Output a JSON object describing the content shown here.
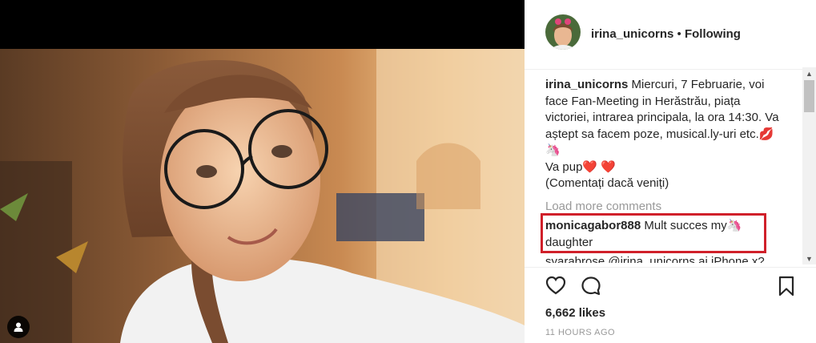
{
  "post": {
    "username": "irina_unicorns",
    "separator": " • ",
    "follow_status": "Following",
    "caption_user": "irina_unicorns",
    "caption_lines": [
      "Miercuri, 7 Februarie, voi",
      "face Fan-Meeting in Herăstrău, piața",
      "victoriei, intrarea principala, la ora 14:30. Va",
      "aștept sa facem poze, musical.ly-uri etc.💋",
      "🦄",
      "Va pup❤️ ❤️",
      "(Comentați dacă veniți)"
    ],
    "load_more": "Load more comments",
    "comments": [
      {
        "user": "monicagabor888",
        "text": "Mult succes my🦄",
        "text2": "daughter"
      },
      {
        "user": "syarabrose",
        "text": "@irina_unicorns ai iPhone x?"
      }
    ],
    "likes": "6,662 likes",
    "time": "11 HOURS AGO"
  },
  "icons": {
    "like": "heart-icon",
    "comment": "comment-icon",
    "save": "bookmark-icon",
    "tag": "user-tag-icon"
  },
  "colors": {
    "highlight": "#d0202a",
    "text": "#262626",
    "muted": "#999999"
  }
}
